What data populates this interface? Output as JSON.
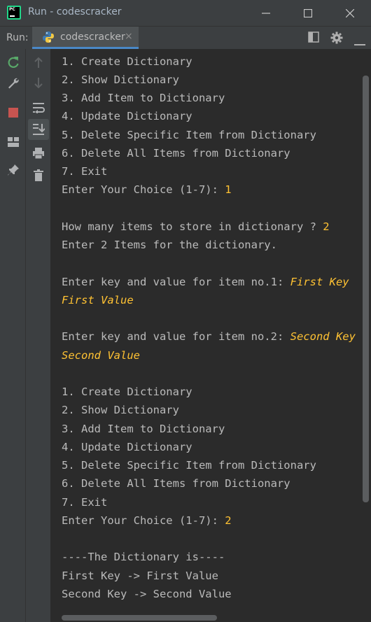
{
  "window": {
    "title": "Run - codescracker"
  },
  "toolbar": {
    "run_label": "Run:",
    "tab_label": "codescracker",
    "tab_close": "×"
  },
  "console": {
    "menu1": [
      "1. Create Dictionary",
      "2. Show Dictionary",
      "3. Add Item to Dictionary",
      "4. Update Dictionary",
      "5. Delete Specific Item from Dictionary",
      "6. Delete All Items from Dictionary",
      "7. Exit"
    ],
    "prompt_choice": "Enter Your Choice (1-7): ",
    "choice1": "1",
    "prompt_count": "How many items to store in dictionary ? ",
    "count": "2",
    "enter_items": "Enter 2 Items for the dictionary.",
    "prompt_item1": "Enter key and value for item no.1: ",
    "item1_key": "First Key",
    "item1_value": "First Value",
    "prompt_item2": "Enter key and value for item no.2: ",
    "item2_key": "Second Key",
    "item2_value": "Second Value",
    "menu2": [
      "1. Create Dictionary",
      "2. Show Dictionary",
      "3. Add Item to Dictionary",
      "4. Update Dictionary",
      "5. Delete Specific Item from Dictionary",
      "6. Delete All Items from Dictionary",
      "7. Exit"
    ],
    "choice2": "2",
    "dict_header": "----The Dictionary is----",
    "dict_line1": "First Key -> First Value",
    "dict_line2": "Second Key -> Second Value"
  },
  "colors": {
    "background": "#2b2b2b",
    "text": "#bbbbbb",
    "user_input": "#ffc233",
    "accent": "#4a88c7"
  },
  "icons": [
    "rerun-icon",
    "wrench-icon",
    "stop-icon",
    "layout-icon",
    "pin-icon",
    "arrow-up-icon",
    "arrow-down-icon",
    "soft-wrap-icon",
    "scroll-to-end-icon",
    "print-icon",
    "trash-icon",
    "layout-toggle-icon",
    "gear-icon",
    "minimize-icon"
  ]
}
